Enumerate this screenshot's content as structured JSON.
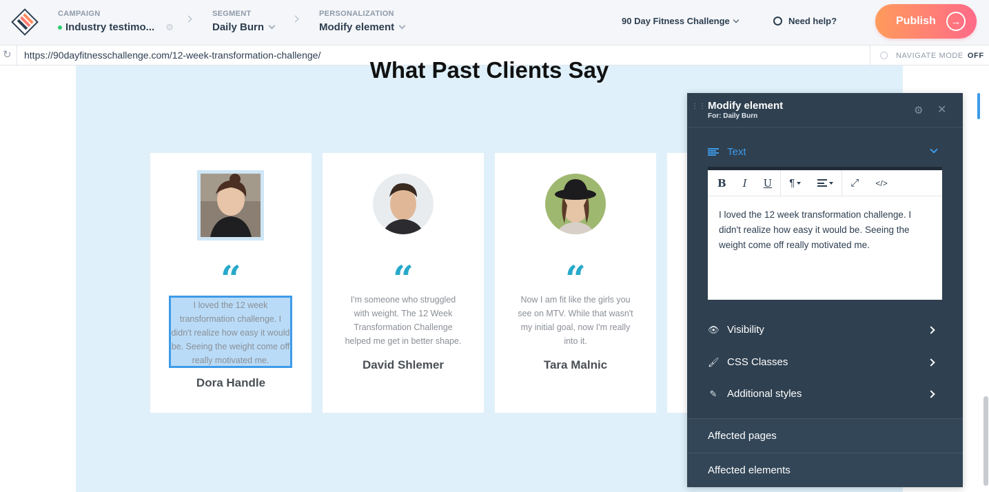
{
  "topbar": {
    "campaign": {
      "label": "CAMPAIGN",
      "value": "Industry testimo..."
    },
    "segment": {
      "label": "SEGMENT",
      "value": "Daily Burn"
    },
    "personalization": {
      "label": "PERSONALIZATION",
      "value": "Modify element"
    },
    "site_selector": "90 Day Fitness Challenge",
    "help": "Need help?",
    "publish": "Publish"
  },
  "urlbar": {
    "url": "https://90dayfitnesschallenge.com/12-week-transformation-challenge/",
    "navigate_mode_label": "NAVIGATE MODE",
    "navigate_mode_state": "OFF"
  },
  "page": {
    "heading": "What Past Clients Say",
    "quote_glyph": "“",
    "testimonials": [
      {
        "text": "I loved the 12 week transformation challenge. I didn't realize how easy it would be. Seeing the weight come off really motivated me.",
        "name": "Dora Handle"
      },
      {
        "text": "I'm someone who struggled with weight. The 12 Week Transformation Challenge helped me get in better shape.",
        "name": "David Shlemer"
      },
      {
        "text": "Now I am fit like the girls you see on MTV. While that wasn't my initial goal, now I'm really into it.",
        "name": "Tara Malnic"
      }
    ]
  },
  "panel": {
    "title": "Modify element",
    "subtitle": "For: Daily Burn",
    "text_section": "Text",
    "toolbar": {
      "bold": "B",
      "italic": "I",
      "underline": "U",
      "paragraph": "¶",
      "code": "</>"
    },
    "editor_text": "I loved the 12 week transformation challenge. I didn't realize how easy it would be. Seeing the weight come off really motivated me.",
    "visibility": "Visibility",
    "css_classes": "CSS Classes",
    "additional_styles": "Additional styles",
    "affected_pages": "Affected pages",
    "affected_elements": "Affected elements"
  },
  "colors": {
    "accent": "#3d9be9",
    "quote": "#27a9c9",
    "panel_bg": "#2f4050",
    "page_bg": "#dff0fa",
    "publish_from": "#ff9b5c",
    "publish_to": "#ff6a88"
  }
}
